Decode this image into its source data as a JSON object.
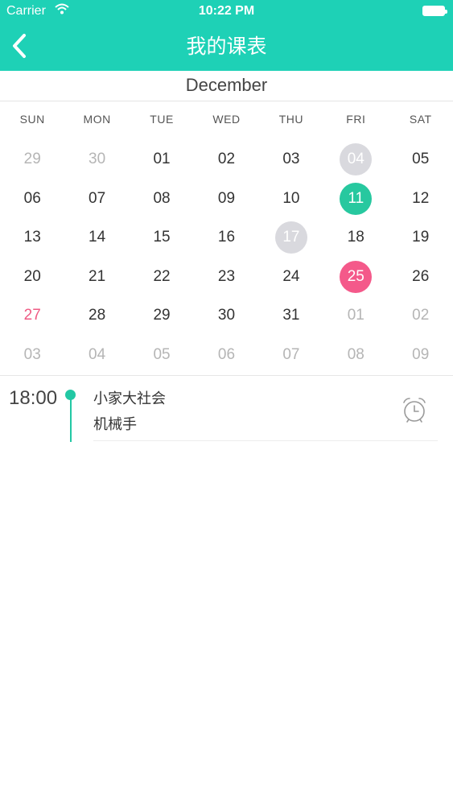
{
  "status": {
    "carrier": "Carrier",
    "time": "10:22 PM"
  },
  "header": {
    "title": "我的课表"
  },
  "calendar": {
    "month": "December",
    "weekdays": [
      "SUN",
      "MON",
      "TUE",
      "WED",
      "THU",
      "FRI",
      "SAT"
    ],
    "weeks": [
      [
        {
          "d": "29",
          "s": "muted"
        },
        {
          "d": "30",
          "s": "muted"
        },
        {
          "d": "01",
          "s": ""
        },
        {
          "d": "02",
          "s": ""
        },
        {
          "d": "03",
          "s": ""
        },
        {
          "d": "04",
          "s": "gray"
        },
        {
          "d": "05",
          "s": ""
        }
      ],
      [
        {
          "d": "06",
          "s": ""
        },
        {
          "d": "07",
          "s": ""
        },
        {
          "d": "08",
          "s": ""
        },
        {
          "d": "09",
          "s": ""
        },
        {
          "d": "10",
          "s": ""
        },
        {
          "d": "11",
          "s": "green"
        },
        {
          "d": "12",
          "s": ""
        }
      ],
      [
        {
          "d": "13",
          "s": ""
        },
        {
          "d": "14",
          "s": ""
        },
        {
          "d": "15",
          "s": ""
        },
        {
          "d": "16",
          "s": ""
        },
        {
          "d": "17",
          "s": "gray"
        },
        {
          "d": "18",
          "s": ""
        },
        {
          "d": "19",
          "s": ""
        }
      ],
      [
        {
          "d": "20",
          "s": ""
        },
        {
          "d": "21",
          "s": ""
        },
        {
          "d": "22",
          "s": ""
        },
        {
          "d": "23",
          "s": ""
        },
        {
          "d": "24",
          "s": ""
        },
        {
          "d": "25",
          "s": "pink"
        },
        {
          "d": "26",
          "s": ""
        }
      ],
      [
        {
          "d": "27",
          "s": "red"
        },
        {
          "d": "28",
          "s": ""
        },
        {
          "d": "29",
          "s": ""
        },
        {
          "d": "30",
          "s": ""
        },
        {
          "d": "31",
          "s": ""
        },
        {
          "d": "01",
          "s": "muted"
        },
        {
          "d": "02",
          "s": "muted"
        }
      ],
      [
        {
          "d": "03",
          "s": "muted"
        },
        {
          "d": "04",
          "s": "muted"
        },
        {
          "d": "05",
          "s": "muted"
        },
        {
          "d": "06",
          "s": "muted"
        },
        {
          "d": "07",
          "s": "muted"
        },
        {
          "d": "08",
          "s": "muted"
        },
        {
          "d": "09",
          "s": "muted"
        }
      ]
    ]
  },
  "schedule": {
    "time": "18:00",
    "title": "小家大社会",
    "subtitle": "机械手",
    "icon": "alarm-clock-icon"
  },
  "colors": {
    "header": "#1ed1b6",
    "today": "#27c89f",
    "highlight": "#f4598a",
    "event_day": "#d9d9de",
    "sunday_red": "#ef5b84"
  }
}
